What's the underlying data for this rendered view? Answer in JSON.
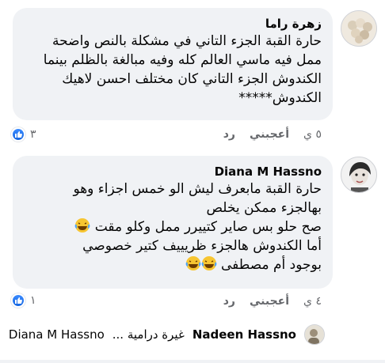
{
  "comments": [
    {
      "author": "زهرة راما",
      "lines": [
        "حارة القبة الجزء التاني في مشكلة بالنص واضحة",
        "ممل فيه ماسي العالم كله وفيه مبالغة بالظلم بينما",
        "الكندوش الجزء التاني كان مختلف احسن لاهيك",
        "الكندوش*****"
      ],
      "time": "٥ ي",
      "like_label": "أعجبني",
      "reply_label": "رد",
      "reaction_count": "٣"
    },
    {
      "author": "Diana M Hassno",
      "lines": [
        "حارة القبة مابعرف ليش الو خمس اجزاء وهو",
        "بهالجزء ممكن يخلص",
        "صح حلو بس صاير كتييرر ممل وكلو مقت",
        "أما الكندوش هالجزء ظريييف كتير خصوصي",
        "بوجود أم مصطفى"
      ],
      "time": "٤ ي",
      "like_label": "أعجبني",
      "reply_label": "رد",
      "reaction_count": "١"
    }
  ],
  "reply_preview": {
    "name": "Nadeen Hassno",
    "snippet": "غيرة درامية ...",
    "mention": "Diana M Hassno"
  },
  "icons": {
    "like": "thumbs-up-icon",
    "laugh": "laughing-emoji-icon"
  },
  "colors": {
    "bubble": "#f0f2f5",
    "meta": "#65676b",
    "like_blue": "#1877f2"
  }
}
